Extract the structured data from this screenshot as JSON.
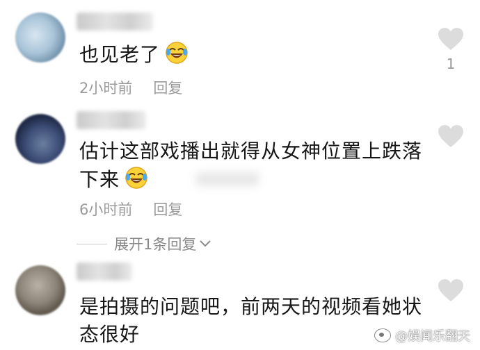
{
  "comments": [
    {
      "text": "也见老了",
      "emoji": "laughing-tears-emoji",
      "time": "2小时前",
      "reply_label": "回复",
      "likes": "1"
    },
    {
      "text_line1": "估计这部戏播出就得从女神位置上跌落",
      "text_line2": "下来",
      "emoji": "laughing-tears-emoji",
      "time": "6小时前",
      "reply_label": "回复",
      "likes": ""
    },
    {
      "text_line1": "是拍摄的问题吧，前两天的视频看她状",
      "text_line2": "态很好",
      "likes": ""
    }
  ],
  "expand_replies": {
    "label": "展开1条回复",
    "icon": "chevron-down-icon"
  },
  "watermark": {
    "text": "@娱闻乐翻天",
    "icon": "weibo-logo"
  },
  "colors": {
    "text": "#161616",
    "meta": "#9a9a9a",
    "heart": "#dcdcdc"
  }
}
